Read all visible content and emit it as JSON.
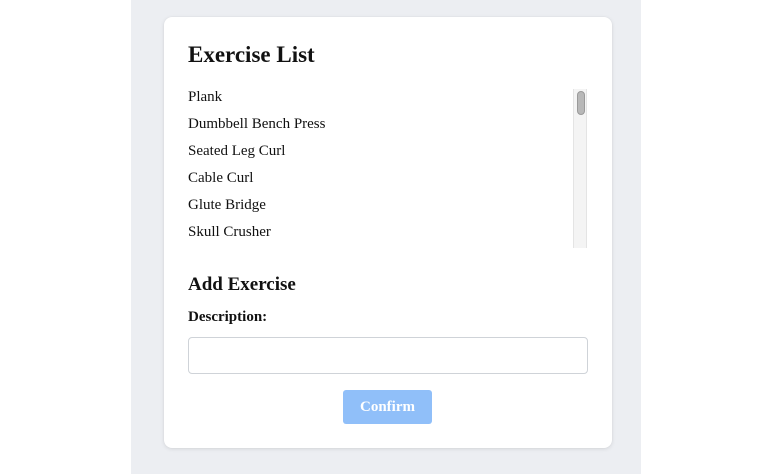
{
  "exercise_list": {
    "title": "Exercise List",
    "items": [
      {
        "label": "Plank"
      },
      {
        "label": "Dumbbell Bench Press"
      },
      {
        "label": "Seated Leg Curl"
      },
      {
        "label": "Cable Curl"
      },
      {
        "label": "Glute Bridge"
      },
      {
        "label": "Skull Crusher"
      }
    ]
  },
  "add_exercise": {
    "title": "Add Exercise",
    "description_label": "Description:",
    "description_value": "",
    "description_placeholder": "",
    "confirm_label": "Confirm"
  },
  "colors": {
    "page_background": "#eceef2",
    "card_background": "#ffffff",
    "button_background": "#90bff9",
    "button_text": "#ffffff"
  }
}
